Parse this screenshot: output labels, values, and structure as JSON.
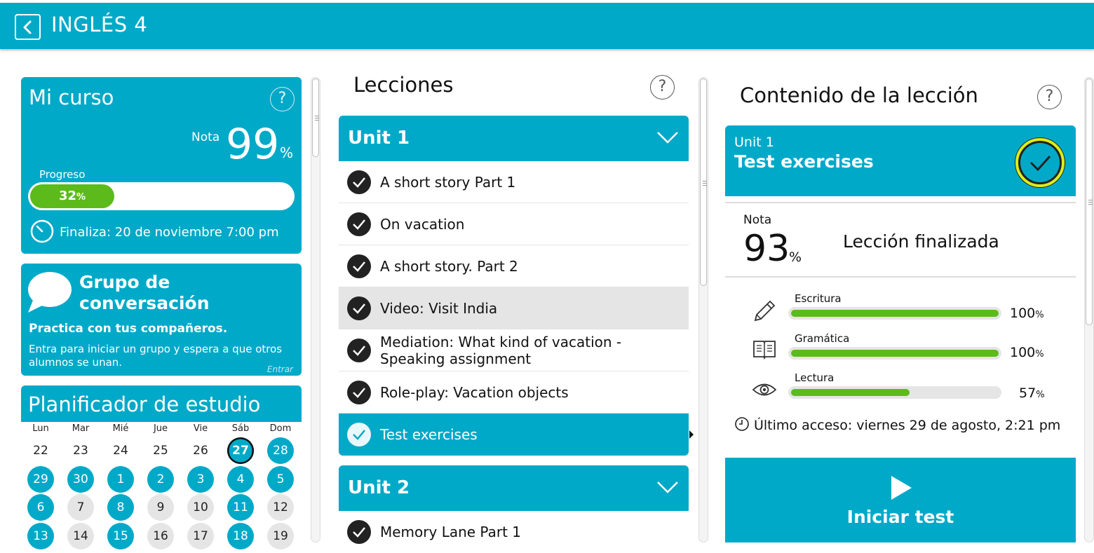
{
  "header": {
    "title": "INGLÉS 4"
  },
  "course": {
    "title": "Mi curso",
    "help": "?",
    "grade_label": "Nota",
    "grade_value": "99",
    "grade_unit": "%",
    "progress_label": "Progreso",
    "progress_value": "32",
    "progress_unit": "%",
    "progress_fraction": 0.32,
    "ends_label": "Finaliza: 20 de noviembre 7:00 pm"
  },
  "group": {
    "title_line1": "Grupo de",
    "title_line2": "conversación",
    "subtitle": "Practica con tus compañeros.",
    "description": "Entra para iniciar un grupo y espera a que otros alumnos se unan.",
    "enter": "Entrar"
  },
  "planner": {
    "title": "Planificador de estudio",
    "weekdays": [
      "Lun",
      "Mar",
      "Mié",
      "Jue",
      "Vie",
      "Sáb",
      "Dom"
    ],
    "rows": [
      [
        {
          "d": "22",
          "s": ""
        },
        {
          "d": "23",
          "s": ""
        },
        {
          "d": "24",
          "s": ""
        },
        {
          "d": "25",
          "s": ""
        },
        {
          "d": "26",
          "s": ""
        },
        {
          "d": "27",
          "s": "today"
        },
        {
          "d": "28",
          "s": "b"
        }
      ],
      [
        {
          "d": "29",
          "s": "b"
        },
        {
          "d": "30",
          "s": "b"
        },
        {
          "d": "1",
          "s": "b"
        },
        {
          "d": "2",
          "s": "b"
        },
        {
          "d": "3",
          "s": "b"
        },
        {
          "d": "4",
          "s": "b"
        },
        {
          "d": "5",
          "s": "b"
        }
      ],
      [
        {
          "d": "6",
          "s": "b"
        },
        {
          "d": "7",
          "s": "g"
        },
        {
          "d": "8",
          "s": "b"
        },
        {
          "d": "9",
          "s": "g"
        },
        {
          "d": "10",
          "s": "g"
        },
        {
          "d": "11",
          "s": "b"
        },
        {
          "d": "12",
          "s": "g"
        }
      ],
      [
        {
          "d": "13",
          "s": "b"
        },
        {
          "d": "14",
          "s": "g"
        },
        {
          "d": "15",
          "s": "b"
        },
        {
          "d": "16",
          "s": "g"
        },
        {
          "d": "17",
          "s": "g"
        },
        {
          "d": "18",
          "s": "b"
        },
        {
          "d": "19",
          "s": "g"
        }
      ]
    ]
  },
  "lessons": {
    "title": "Lecciones",
    "help": "?",
    "unit1": "Unit 1",
    "unit2": "Unit 2",
    "items": [
      "A short story Part 1",
      "On vacation",
      "A short story. Part 2",
      "Video: Visit India",
      "Mediation: What kind of vacation - Speaking assignment",
      "Role-play: Vacation objects",
      "Test exercises"
    ],
    "unit2_items": [
      "Memory Lane Part 1"
    ]
  },
  "content": {
    "title": "Contenido de la lección",
    "help": "?",
    "unit": "Unit 1",
    "lesson": "Test exercises",
    "grade_label": "Nota",
    "grade_value": "93",
    "grade_unit": "%",
    "status": "Lección finalizada",
    "skills": [
      {
        "name": "Escritura",
        "value": "100",
        "unit": "%",
        "fraction": 1.0,
        "icon": "pencil-icon"
      },
      {
        "name": "Gramática",
        "value": "100",
        "unit": "%",
        "fraction": 1.0,
        "icon": "book-icon"
      },
      {
        "name": "Lectura",
        "value": "57",
        "unit": "%",
        "fraction": 0.57,
        "icon": "eye-icon"
      }
    ],
    "last_access": "Último acceso: viernes 29 de agosto, 2:21 pm",
    "start": "Iniciar test"
  },
  "colors": {
    "accent": "#00a9c8",
    "progress": "#5cbb1a",
    "check": "#222222",
    "badge_ring": "#d9ee1a"
  }
}
